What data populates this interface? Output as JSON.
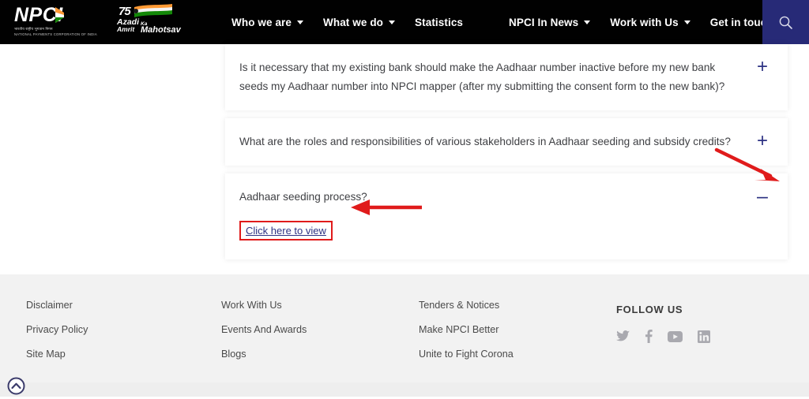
{
  "header": {
    "logo": {
      "brand_name": "NPCI",
      "tagline_hi": "भारतीय राष्ट्रीय भुगतान निगम",
      "tagline_en": "NATIONAL PAYMENTS CORPORATION OF INDIA",
      "icon": "npci-flag-icon"
    },
    "azadi": {
      "number": "75",
      "line1": "Azadi",
      "ka": "Ka",
      "line2": "Amrit",
      "line3": "Mahotsav",
      "icon": "india-flag-ribbon-icon"
    },
    "nav": [
      {
        "label": "Who we are",
        "has_dropdown": true
      },
      {
        "label": "What we do",
        "has_dropdown": true
      },
      {
        "label": "Statistics",
        "has_dropdown": false
      },
      {
        "label": "NPCI In News",
        "has_dropdown": true
      },
      {
        "label": "Work with Us",
        "has_dropdown": true
      },
      {
        "label": "Get in touch",
        "has_dropdown": false
      }
    ],
    "search": {
      "icon": "search-icon",
      "bg": "#272a77"
    }
  },
  "faq": {
    "items": [
      {
        "question": "Is it necessary that my existing bank should make the Aadhaar number inactive before my new bank seeds my Aadhaar number into NPCI mapper (after my submitting the consent form to the new bank)?",
        "expanded": false,
        "toggle_icon": "plus-icon",
        "toggle_glyph": "+"
      },
      {
        "question": "What are the roles and responsibilities of various stakeholders in Aadhaar seeding and subsidy credits?",
        "expanded": false,
        "toggle_icon": "plus-icon",
        "toggle_glyph": "+"
      },
      {
        "question": "Aadhaar seeding process?",
        "expanded": true,
        "toggle_icon": "minus-icon",
        "toggle_glyph": "–",
        "answer_link": "Click here to view"
      }
    ]
  },
  "annotations": {
    "color": "#e01b1b",
    "arrow_to_minus": "diagonal-arrow-pointing-to-collapse-icon",
    "arrow_to_link": "horizontal-arrow-pointing-to-click-here-link",
    "highlight_box": "red-box-around-click-here-link"
  },
  "footer": {
    "columns": [
      {
        "links": [
          "Disclaimer",
          "Privacy Policy",
          "Site Map"
        ]
      },
      {
        "links": [
          "Work With Us",
          "Events And Awards",
          "Blogs"
        ]
      },
      {
        "links": [
          "Tenders & Notices",
          "Make NPCI Better",
          "Unite to Fight Corona"
        ]
      }
    ],
    "follow": {
      "title": "FOLLOW US",
      "socials": [
        "twitter-icon",
        "facebook-icon",
        "youtube-icon",
        "linkedin-icon"
      ]
    },
    "scroll_top_icon": "chevron-up-circle-icon"
  }
}
